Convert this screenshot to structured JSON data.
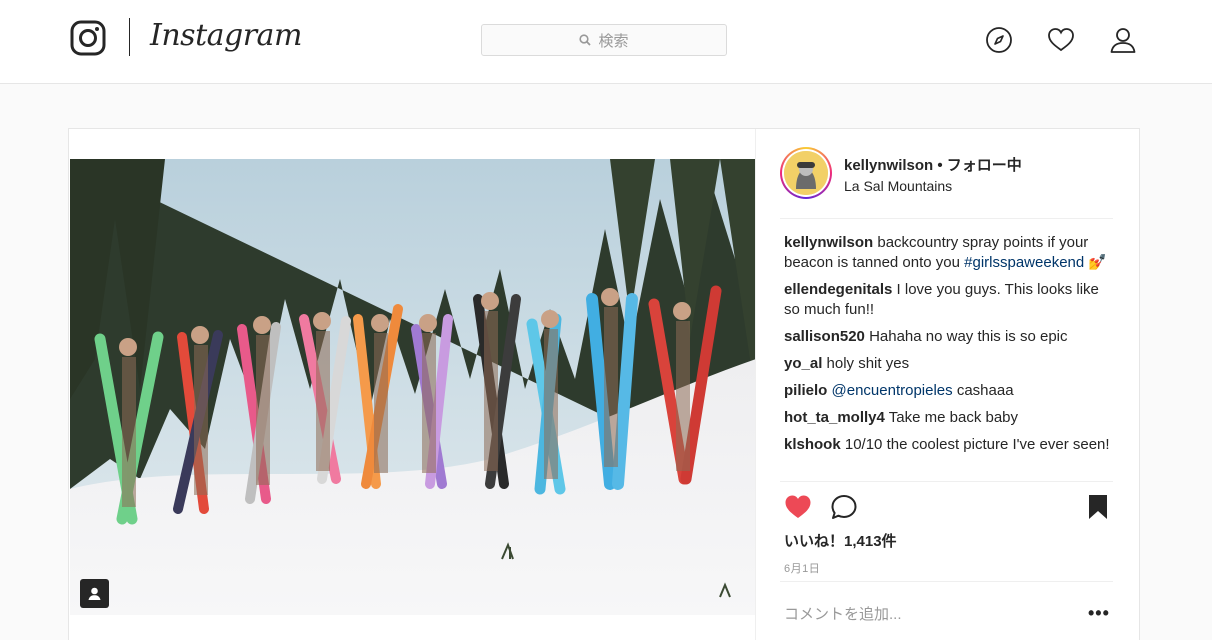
{
  "app": {
    "brand": "Instagram"
  },
  "search": {
    "placeholder": "検索"
  },
  "nav": {
    "icons": [
      "compass-icon",
      "heart-icon",
      "user-icon"
    ]
  },
  "post": {
    "username": "kellynwilson",
    "separator": " • ",
    "follow_status": "フォロー中",
    "location": "La Sal Mountains",
    "caption": {
      "user": "kellynwilson",
      "text": "backcountry spray points if your beacon is tanned onto you",
      "hashtag": "#girlsspaweekend",
      "emoji": "💅"
    },
    "comments": [
      {
        "user": "ellendegenitals",
        "text": "I love you guys. This looks like so much fun!!"
      },
      {
        "user": "sallison520",
        "text": "Hahaha no way this is so epic"
      },
      {
        "user": "yo_al",
        "text": "holy shit yes"
      },
      {
        "user": "pilielo",
        "mention": "@encuentropieles",
        "text": "cashaaa"
      },
      {
        "user": "hot_ta_molly4",
        "text": "Take me back baby"
      },
      {
        "user": "klshook",
        "text": "10/10 the coolest picture I've ever seen!"
      }
    ],
    "likes": "いいね！1,413件",
    "date": "6月1日",
    "add_comment_placeholder": "コメントを追加...",
    "more_label": "•••",
    "liked": true,
    "colors": {
      "like_red": "#ed4956",
      "hashtag_blue": "#003569"
    }
  }
}
